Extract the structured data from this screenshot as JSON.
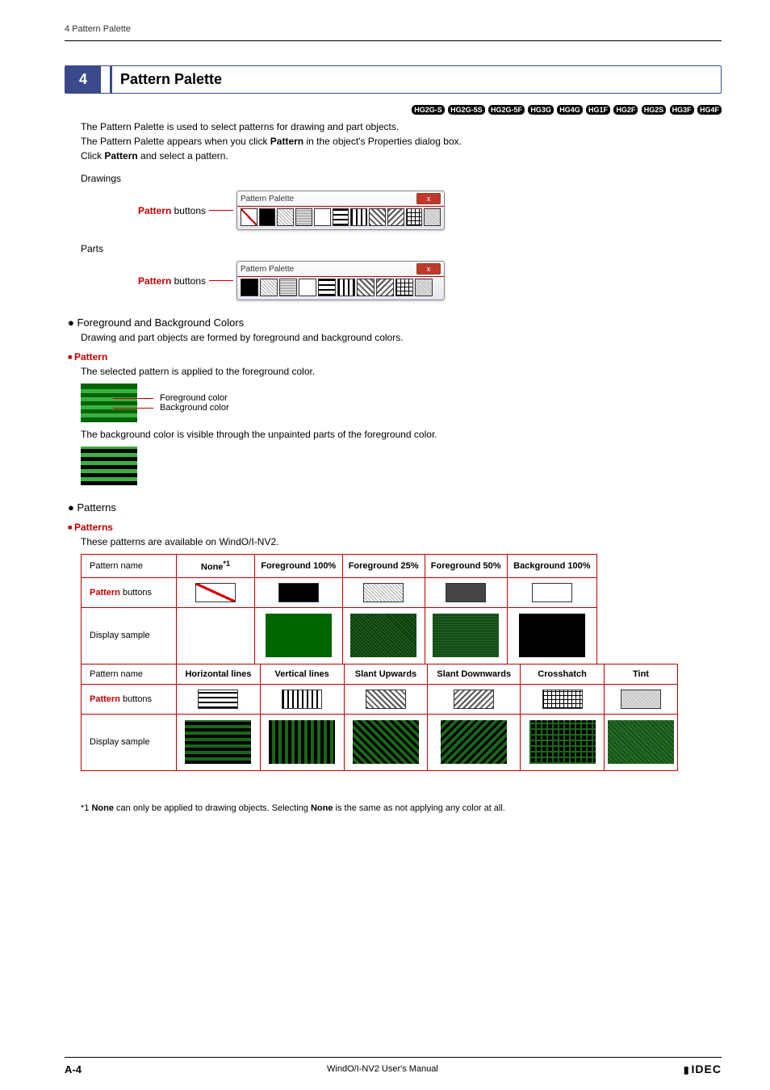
{
  "header": {
    "running": "4 Pattern Palette"
  },
  "title": {
    "num": "4",
    "text": "Pattern Palette"
  },
  "badges": [
    "HG2G-S",
    "HG2G-5S",
    "HG2G-5F",
    "HG3G",
    "HG4G",
    "HG1F",
    "HG2F",
    "HG2S",
    "HG3F",
    "HG4F"
  ],
  "intro": {
    "p1": "The Pattern Palette is used to select patterns for drawing and part objects.",
    "p2_a": "The Pattern Palette appears when you click ",
    "p2_b": "Pattern",
    "p2_c": " in the object's Properties dialog box.",
    "p3_a": "Click ",
    "p3_b": "Pattern",
    "p3_c": " and select a pattern."
  },
  "labels": {
    "drawings": "Drawings",
    "parts": "Parts",
    "pattern_buttons_a": "Pattern",
    "pattern_buttons_b": " buttons",
    "palette_title": "Pattern Palette",
    "close": "x"
  },
  "fgbg": {
    "heading": "Foreground and Background Colors",
    "desc": "Drawing and part objects are formed by foreground and background colors.",
    "sub": "Pattern",
    "line1": "The selected pattern is applied to the foreground color.",
    "callout_fg": "Foreground color",
    "callout_bg": "Background color",
    "line2": "The background color is visible through the unpainted parts of the foreground color."
  },
  "patterns": {
    "heading": "Patterns",
    "sub": "Patterns",
    "desc": "These patterns are available on WindO/I-NV2.",
    "row_name": "Pattern name",
    "row_btn_a": "Pattern",
    "row_btn_b": " buttons",
    "row_disp": "Display sample",
    "cols1": [
      "None*1",
      "Foreground 100%",
      "Foreground 25%",
      "Foreground 50%",
      "Background 100%"
    ],
    "cols2": [
      "Horizontal lines",
      "Vertical lines",
      "Slant Upwards",
      "Slant Downwards",
      "Crosshatch",
      "Tint"
    ],
    "none_sup_base": "None",
    "none_sup_s": "*1"
  },
  "footnote": {
    "prefix": "*1 ",
    "b1": "None",
    "mid": " can only be applied to drawing objects. Selecting ",
    "b2": "None",
    "suffix": " is the same as not applying any color at all."
  },
  "footer": {
    "page": "A-4",
    "manual": "WindO/I-NV2 User's Manual",
    "logo": "IDEC"
  }
}
